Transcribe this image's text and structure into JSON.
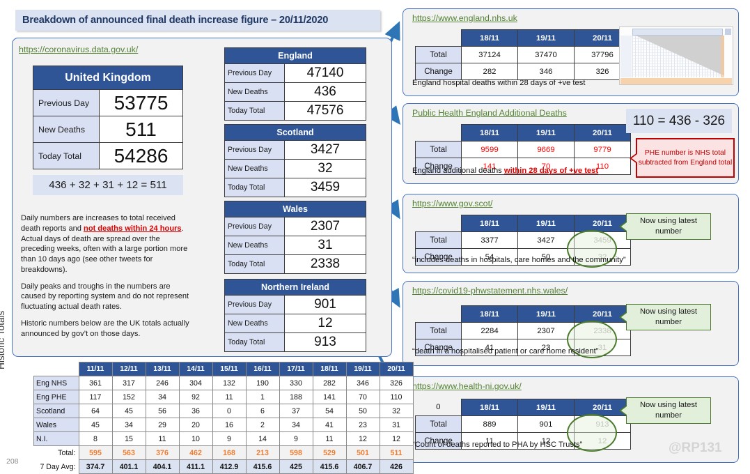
{
  "title": "Breakdown of announced final death increase figure – 20/11/2020",
  "slide_number": "208",
  "watermark": "@RP131",
  "left": {
    "source_link": "https://coronavirus.data.gov.uk/",
    "uk_table": {
      "header": "United Kingdom",
      "rows": [
        {
          "label": "Previous Day",
          "value": "53775"
        },
        {
          "label": "New Deaths",
          "value": "511"
        },
        {
          "label": "Today Total",
          "value": "54286"
        }
      ]
    },
    "formula": "436 + 32 + 31 + 12 = 511",
    "notes": [
      {
        "pre": "Daily numbers are increases to total received death reports and ",
        "emph": "not deaths within 24 hours",
        "post": ". Actual days of death are spread over the preceding weeks, often with a large portion more than 10 days ago (see other tweets for breakdowns)."
      },
      {
        "pre": "Daily peaks and troughs in the numbers are caused by reporting system and do not represent fluctuating actual death rates.",
        "emph": "",
        "post": ""
      },
      {
        "pre": "Historic numbers below are the UK totals actually announced by gov’t on those days.",
        "emph": "",
        "post": ""
      }
    ]
  },
  "nations": [
    {
      "name": "England",
      "rows": [
        {
          "label": "Previous Day",
          "value": "47140"
        },
        {
          "label": "New Deaths",
          "value": "436"
        },
        {
          "label": "Today Total",
          "value": "47576"
        }
      ]
    },
    {
      "name": "Scotland",
      "rows": [
        {
          "label": "Previous Day",
          "value": "3427"
        },
        {
          "label": "New Deaths",
          "value": "32"
        },
        {
          "label": "Today Total",
          "value": "3459"
        }
      ]
    },
    {
      "name": "Wales",
      "rows": [
        {
          "label": "Previous Day",
          "value": "2307"
        },
        {
          "label": "New Deaths",
          "value": "31"
        },
        {
          "label": "Today Total",
          "value": "2338"
        }
      ]
    },
    {
      "name": "Northern Ireland",
      "rows": [
        {
          "label": "Previous Day",
          "value": "901"
        },
        {
          "label": "New Deaths",
          "value": "12"
        },
        {
          "label": "Today Total",
          "value": "913"
        }
      ]
    }
  ],
  "sources": [
    {
      "link": "https://www.england.nhs.uk",
      "corner": "",
      "dates": [
        "18/11",
        "19/11",
        "20/11"
      ],
      "total_label": "Total",
      "change_label": "Change",
      "total": [
        "37124",
        "37470",
        "37796"
      ],
      "change": [
        "282",
        "346",
        "326"
      ],
      "caption_pre": "England hospital deaths within 28 days of +ve test",
      "caption_emph": "",
      "caption_post": "",
      "callout": "",
      "highlight": false
    },
    {
      "link": "Public Health England Additional Deaths",
      "corner": "",
      "dates": [
        "18/11",
        "19/11",
        "20/11"
      ],
      "total_label": "Total",
      "change_label": "Change",
      "total": [
        "9599",
        "9669",
        "9779"
      ],
      "change": [
        "141",
        "70",
        "110"
      ],
      "caption_pre": "England additional deaths ",
      "caption_emph": "within 28 days of +ve test",
      "caption_post": "",
      "callout": "",
      "highlight": false
    },
    {
      "link": "https://www.gov.scot/",
      "corner": "",
      "dates": [
        "18/11",
        "19/11",
        "20/11"
      ],
      "total_label": "Total",
      "change_label": "Change",
      "total": [
        "3377",
        "3427",
        "3459"
      ],
      "change": [
        "54",
        "50",
        "32"
      ],
      "caption_pre": "“includes deaths in hospitals, care homes and the community”",
      "caption_emph": "",
      "caption_post": "",
      "callout": "Now using latest number",
      "highlight": true
    },
    {
      "link": "https://covid19-phwstatement.nhs.wales/",
      "corner": "",
      "dates": [
        "18/11",
        "19/11",
        "20/11"
      ],
      "total_label": "Total",
      "change_label": "Change",
      "total": [
        "2284",
        "2307",
        "2338"
      ],
      "change": [
        "41",
        "23",
        "31"
      ],
      "caption_pre": "“death in a hospitalised patient or care home resident”",
      "caption_emph": "",
      "caption_post": "",
      "callout": "Now using latest number",
      "highlight": true
    },
    {
      "link": "https://www.health-ni.gov.uk/",
      "corner": "0",
      "dates": [
        "18/11",
        "19/11",
        "20/11"
      ],
      "total_label": "Total",
      "change_label": "Change",
      "total": [
        "889",
        "901",
        "913"
      ],
      "change": [
        "11",
        "12",
        "12"
      ],
      "caption_pre": "“Count of deaths reported to PHA by HSC Trusts”",
      "caption_emph": "",
      "caption_post": "",
      "callout": "Now using latest number",
      "highlight": true
    }
  ],
  "phe_calc": "110 = 436 - 326",
  "phe_callout": "PHE number is NHS total subtracted from England total",
  "historic": {
    "vertical_label": "Historic Totals",
    "dates": [
      "11/11",
      "12/11",
      "13/11",
      "14/11",
      "15/11",
      "16/11",
      "17/11",
      "18/11",
      "19/11",
      "20/11"
    ],
    "rows": [
      {
        "label": "Eng NHS",
        "values": [
          "361",
          "317",
          "246",
          "304",
          "132",
          "190",
          "330",
          "282",
          "346",
          "326"
        ]
      },
      {
        "label": "Eng PHE",
        "values": [
          "117",
          "152",
          "34",
          "92",
          "11",
          "1",
          "188",
          "141",
          "70",
          "110"
        ]
      },
      {
        "label": "Scotland",
        "values": [
          "64",
          "45",
          "56",
          "36",
          "0",
          "6",
          "37",
          "54",
          "50",
          "32"
        ]
      },
      {
        "label": "Wales",
        "values": [
          "45",
          "34",
          "29",
          "20",
          "16",
          "2",
          "34",
          "41",
          "23",
          "31"
        ]
      },
      {
        "label": "N.I.",
        "values": [
          "8",
          "15",
          "11",
          "10",
          "9",
          "14",
          "9",
          "11",
          "12",
          "12"
        ]
      }
    ],
    "total_label": "Total:",
    "total_values": [
      "595",
      "563",
      "376",
      "462",
      "168",
      "213",
      "598",
      "529",
      "501",
      "511"
    ],
    "avg_label": "7 Day Avg:",
    "avg_values": [
      "374.7",
      "401.1",
      "404.1",
      "411.1",
      "412.9",
      "415.6",
      "425",
      "415.6",
      "406.7",
      "426"
    ]
  },
  "colors": {
    "header_blue": "#2f5597",
    "panel_border": "#4472c4",
    "link_green": "#548235",
    "accent_red": "#c00000",
    "callout_green": "#4a7a2b",
    "total_orange": "#ed7d31"
  }
}
